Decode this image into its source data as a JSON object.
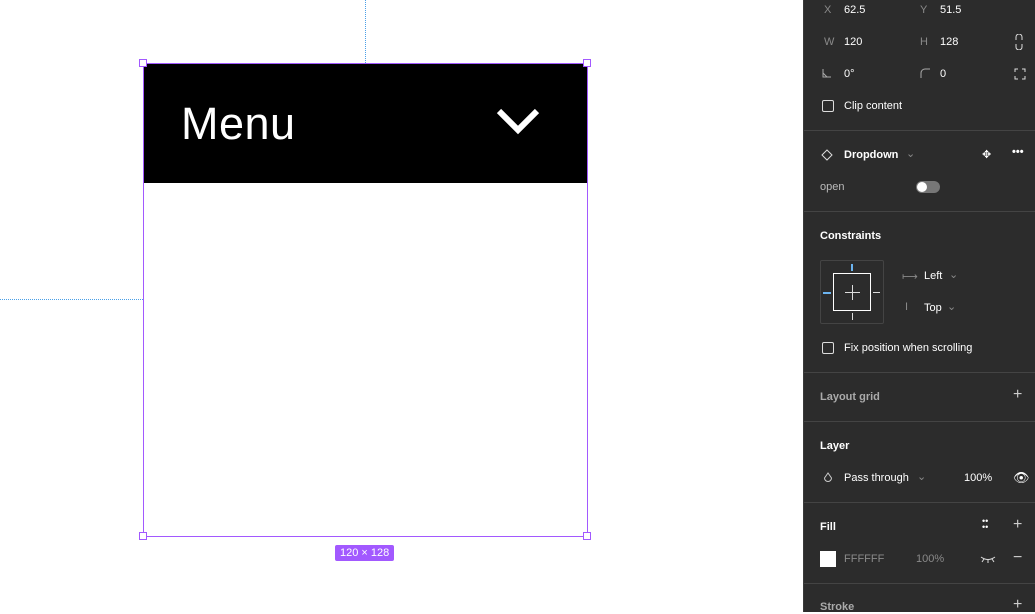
{
  "canvas": {
    "frame_title": "Menu",
    "chevron_icon": "chevron-down-icon",
    "size_badge": "120 × 128",
    "accent": "#a259ff",
    "header_color": "#000000"
  },
  "panel": {
    "x_label": "X",
    "x_value": "62.5",
    "y_label": "Y",
    "y_value": "51.5",
    "w_label": "W",
    "w_value": "120",
    "h_label": "H",
    "h_value": "128",
    "rotation_value": "0°",
    "radius_value": "0",
    "clip_content": "Clip content",
    "component_name": "Dropdown",
    "property_label": "open",
    "constraints_title": "Constraints",
    "horizontal": "Left",
    "vertical": "Top",
    "fix_position": "Fix position when scrolling",
    "layout_grid_title": "Layout grid",
    "layer_title": "Layer",
    "blend_mode": "Pass through",
    "layer_opacity": "100%",
    "fill_title": "Fill",
    "fill_hex": "FFFFFF",
    "fill_opacity": "100%",
    "stroke_title": "Stroke"
  }
}
